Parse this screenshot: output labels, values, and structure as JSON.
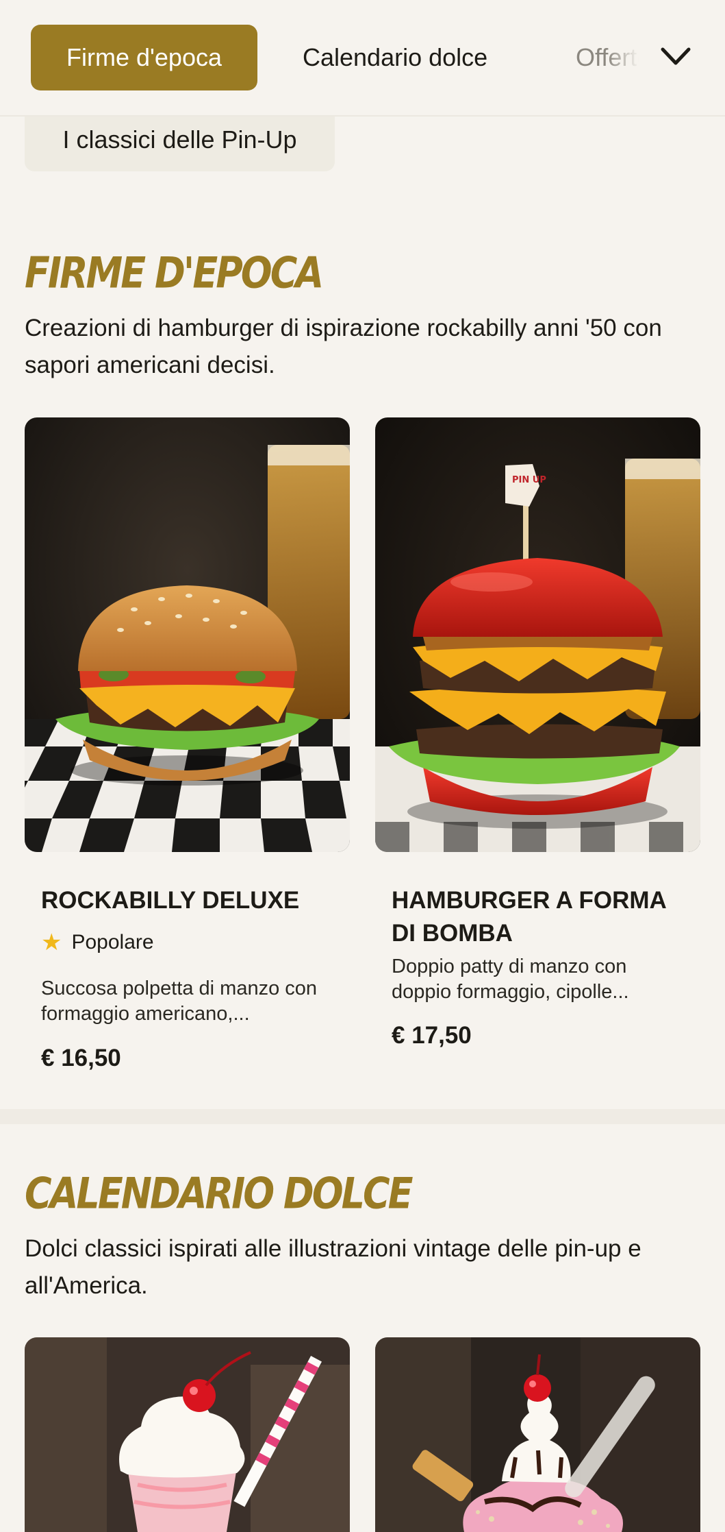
{
  "nav": {
    "tabs": [
      {
        "label": "Firme d'epoca",
        "active": true
      },
      {
        "label": "Calendario dolce",
        "active": false
      },
      {
        "label": "Offerte",
        "active": false
      }
    ],
    "chips": [
      {
        "label": "I classici delle Pin-Up"
      }
    ],
    "expand_icon": "chevron-down-icon"
  },
  "sections": [
    {
      "title": "Firme d'epoca",
      "description": "Creazioni di hamburger di ispirazione rockabilly anni '50 con sapori americani decisi.",
      "items": [
        {
          "name": "ROCKABILLY DELUXE",
          "badge": "Popolare",
          "description": "Succosa polpetta di manzo con formaggio americano,...",
          "price": "€ 16,50",
          "image": "burger-rockabilly"
        },
        {
          "name": "HAMBURGER A FORMA DI BOMBA",
          "description": "Doppio patty di manzo con doppio formaggio, cipolle...",
          "price": "€ 17,50",
          "image": "burger-bomba",
          "flag_text": "PIN UP"
        }
      ]
    },
    {
      "title": "Calendario dolce",
      "description": "Dolci classici ispirati alle illustrazioni vintage delle pin-up e all'America.",
      "items": [
        {
          "image": "milkshake-strawberry"
        },
        {
          "image": "sundae-cherry"
        }
      ]
    }
  ],
  "colors": {
    "accent": "#9a7b23",
    "background": "#f6f3ee",
    "chip_bg": "#eeebe2",
    "star": "#f0b81b"
  }
}
